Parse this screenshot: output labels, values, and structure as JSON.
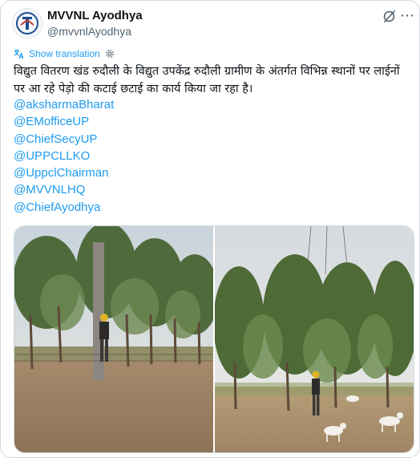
{
  "author": {
    "name": "MVVNL Ayodhya",
    "handle": "@mvvnlAyodhya"
  },
  "translate": {
    "label": "Show translation"
  },
  "tweet": {
    "text": "विद्युत वितरण खंड रुदौली के विद्युत उपकेंद्र रुदौली ग्रामीण के अंतर्गत विभिन्न स्थानों पर लाईनों पर आ रहे पेड़ो की कटाई छटाई का कार्य किया जा रहा है।",
    "mentions": [
      "@aksharmaBharat",
      "@EMofficeUP",
      "@ChiefSecyUP",
      "@UPPCLLKO",
      "@UppclChairman",
      "@MVVNLHQ",
      "@ChiefAyodhya"
    ]
  },
  "icons": {
    "avatar": "mvvnl-logo-icon",
    "x_logo": "grok-icon",
    "more": "more-icon",
    "translate": "gear-icon"
  },
  "colors": {
    "link": "#1d9bf0",
    "text": "#0f1419",
    "secondary": "#536471",
    "border": "#cfd9de"
  }
}
